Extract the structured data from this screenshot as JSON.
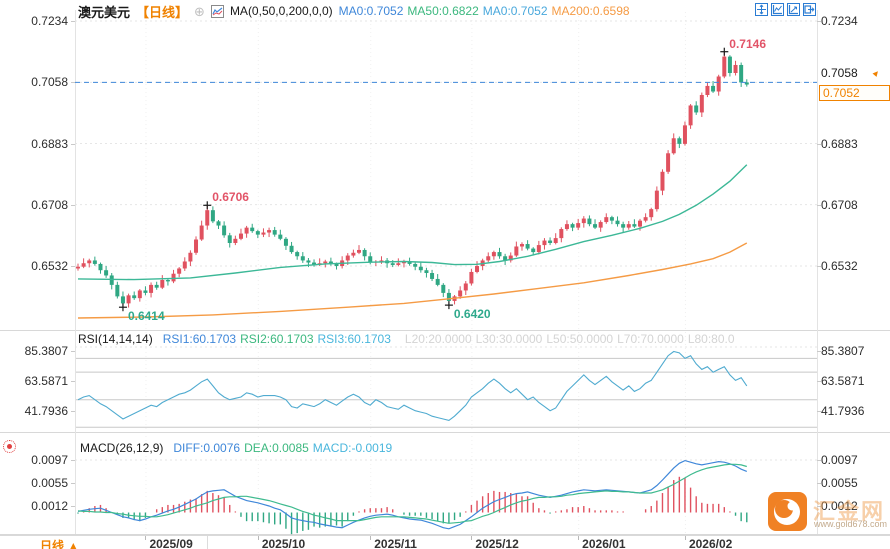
{
  "header": {
    "symbol": "澳元美元",
    "period": "【日线】",
    "collapse_icon": "⊕",
    "ma_label": "MA(0,50,0,200,0,0)",
    "ma_values": [
      {
        "label": "MA0:0.7052",
        "color": "#3f87d9"
      },
      {
        "label": "MA50:0.6822",
        "color": "#3cb87f"
      },
      {
        "label": "MA0:0.7052",
        "color": "#49a8dc"
      },
      {
        "label": "MA200:0.6598",
        "color": "#f59b45"
      }
    ]
  },
  "toolbar_icons": [
    "move-icon",
    "fit-chart-icon",
    "axis-scale-icon",
    "pan-right-icon"
  ],
  "rsi_header": {
    "title": "RSI(14,14,14)",
    "values": [
      {
        "label": "RSI1:60.1703",
        "color": "#3f87d9"
      },
      {
        "label": "RSI2:60.1703",
        "color": "#3cb87f"
      },
      {
        "label": "RSI3:60.1703",
        "color": "#49b6dc"
      }
    ],
    "levels": [
      "L20:20.0000",
      "L30:30.0000",
      "L50:50.0000",
      "L70:70.0000",
      "L80:80.0"
    ]
  },
  "macd_header": {
    "title": "MACD(26,12,9)",
    "values": [
      {
        "label": "DIFF:0.0076",
        "color": "#3f87d9"
      },
      {
        "label": "DEA:0.0085",
        "color": "#3cb87f"
      },
      {
        "label": "MACD:-0.0019",
        "color": "#49b6dc"
      }
    ]
  },
  "right_tags": {
    "prev_close": "0.7058",
    "arrow": "▲",
    "current": "0.7052"
  },
  "bottom_bar": {
    "period": "日线",
    "arrow": "▲"
  },
  "watermark": {
    "name": "汇金网",
    "url": "www.gold678.com"
  },
  "colors": {
    "up": "#e0515f",
    "down": "#2fa783",
    "ma50": "#3cb897",
    "ma200": "#f59b45",
    "rsi_line": "#50abd0",
    "diff": "#3f87d9",
    "dea": "#3fbb8f",
    "hist_up": "#e0515f",
    "hist_down": "#2fa783",
    "accent": "#f08200",
    "icon_blue": "#2b7cd3",
    "grid": "#e6e6e6",
    "rsi_grid": "#c8c8c8",
    "axis_text": "#2d2d2d",
    "dash_line": "#3f87d9",
    "cross": "#1a1a1a",
    "ann_up": "#e25468",
    "ann_down": "#2fa98c"
  },
  "chart_data": {
    "type": "candlestick",
    "title": "澳元美元 日线 (AUD/USD daily with MA, RSI, MACD)",
    "price_axis_labels": [
      0.7234,
      0.7058,
      0.6883,
      0.6708,
      0.6532
    ],
    "price_ylim": [
      0.6343,
      0.72655
    ],
    "prev_close_line": 0.7058,
    "current_price": 0.7052,
    "closes": [
      0.653,
      0.654,
      0.6548,
      0.6538,
      0.652,
      0.6505,
      0.6478,
      0.6445,
      0.6425,
      0.6448,
      0.644,
      0.6462,
      0.6455,
      0.6478,
      0.647,
      0.6492,
      0.6488,
      0.651,
      0.6525,
      0.6545,
      0.657,
      0.6608,
      0.6648,
      0.6692,
      0.666,
      0.6648,
      0.662,
      0.6598,
      0.661,
      0.6625,
      0.6642,
      0.6632,
      0.6622,
      0.6628,
      0.6635,
      0.6622,
      0.661,
      0.659,
      0.6572,
      0.656,
      0.6548,
      0.6542,
      0.6536,
      0.654,
      0.6545,
      0.6538,
      0.6532,
      0.6548,
      0.6562,
      0.657,
      0.6578,
      0.656,
      0.6542,
      0.6545,
      0.6548,
      0.654,
      0.6535,
      0.654,
      0.6545,
      0.6538,
      0.653,
      0.652,
      0.6512,
      0.6495,
      0.6478,
      0.6455,
      0.6432,
      0.6445,
      0.6462,
      0.6482,
      0.6515,
      0.6532,
      0.6548,
      0.656,
      0.6572,
      0.656,
      0.6548,
      0.6562,
      0.6588,
      0.6595,
      0.6582,
      0.6572,
      0.6592,
      0.6605,
      0.6598,
      0.6612,
      0.6638,
      0.6652,
      0.6642,
      0.6655,
      0.6668,
      0.6652,
      0.6642,
      0.6658,
      0.6672,
      0.6662,
      0.6652,
      0.6642,
      0.6652,
      0.6645,
      0.6662,
      0.6672,
      0.6695,
      0.6748,
      0.6802,
      0.6855,
      0.6898,
      0.6882,
      0.6935,
      0.6992,
      0.6972,
      0.7022,
      0.7048,
      0.7032,
      0.7075,
      0.7132,
      0.7085,
      0.7108,
      0.7058,
      0.7052
    ],
    "first_open": 0.6525,
    "wick_up_cycle": [
      0.0009,
      0.0014,
      0.0005,
      0.0011,
      0.0004,
      0.0012,
      0.0007
    ],
    "wick_dn_cycle": [
      0.0006,
      0.0004,
      0.0012,
      0.0005,
      0.001,
      0.0007,
      0.0013
    ],
    "extremes": {
      "8": {
        "low": 0.6414
      },
      "23": {
        "high": 0.6706
      },
      "66": {
        "low": 0.642
      },
      "115": {
        "high": 0.7146
      }
    },
    "annotations": [
      {
        "index": 8,
        "pos": "low",
        "text": "0.6414"
      },
      {
        "index": 23,
        "pos": "high",
        "text": "0.6706"
      },
      {
        "index": 66,
        "pos": "low",
        "text": "0.6420"
      },
      {
        "index": 115,
        "pos": "high",
        "text": "0.7146"
      }
    ],
    "ma50_points": [
      [
        0,
        0.6495
      ],
      [
        10,
        0.6493
      ],
      [
        20,
        0.6498
      ],
      [
        28,
        0.6512
      ],
      [
        36,
        0.6528
      ],
      [
        44,
        0.6538
      ],
      [
        52,
        0.6543
      ],
      [
        58,
        0.6545
      ],
      [
        63,
        0.6542
      ],
      [
        67,
        0.6536
      ],
      [
        71,
        0.6537
      ],
      [
        75,
        0.6545
      ],
      [
        80,
        0.656
      ],
      [
        85,
        0.658
      ],
      [
        90,
        0.6602
      ],
      [
        95,
        0.662
      ],
      [
        100,
        0.664
      ],
      [
        104,
        0.666
      ],
      [
        107,
        0.668
      ],
      [
        110,
        0.6706
      ],
      [
        113,
        0.6738
      ],
      [
        116,
        0.6775
      ],
      [
        119,
        0.6822
      ]
    ],
    "ma200_points": [
      [
        0,
        0.6383
      ],
      [
        12,
        0.6386
      ],
      [
        24,
        0.6392
      ],
      [
        36,
        0.6402
      ],
      [
        48,
        0.6414
      ],
      [
        58,
        0.6425
      ],
      [
        66,
        0.6438
      ],
      [
        74,
        0.6452
      ],
      [
        82,
        0.6468
      ],
      [
        90,
        0.6484
      ],
      [
        98,
        0.6505
      ],
      [
        104,
        0.6522
      ],
      [
        109,
        0.6538
      ],
      [
        113,
        0.6553
      ],
      [
        116,
        0.6572
      ],
      [
        119,
        0.6598
      ]
    ],
    "rsi_axis_labels": [
      85.3807,
      63.5871,
      41.7936
    ],
    "rsi_ylim": [
      26.54,
      88.29
    ],
    "rsi_gridlines": [
      80,
      70,
      50,
      30
    ],
    "rsi": [
      50,
      52,
      53,
      50,
      47,
      45,
      42,
      39,
      36,
      38,
      40,
      42,
      44,
      46,
      45,
      48,
      50,
      52,
      54,
      55,
      57,
      60,
      63,
      65,
      60,
      55,
      52,
      50,
      51,
      52,
      55,
      54,
      52,
      53,
      53,
      53,
      52,
      50,
      45,
      44,
      47,
      46,
      45,
      47,
      50,
      48,
      46,
      49,
      52,
      54,
      52,
      48,
      46,
      50,
      48,
      45,
      44,
      43,
      46,
      44,
      42,
      41,
      40,
      38,
      37,
      36,
      35,
      38,
      42,
      46,
      52,
      55,
      58,
      62,
      65,
      62,
      58,
      55,
      58,
      54,
      50,
      52,
      48,
      45,
      42,
      44,
      50,
      56,
      60,
      64,
      68,
      64,
      61,
      64,
      67,
      63,
      60,
      57,
      60,
      56,
      58,
      62,
      64,
      70,
      76,
      82,
      85,
      84,
      80,
      82,
      76,
      72,
      74,
      70,
      72,
      74,
      68,
      64,
      66,
      60
    ],
    "macd_axis_labels": [
      0.0097,
      0.0055,
      0.0012
    ],
    "macd_ylim": [
      -0.0036,
      0.01118
    ],
    "macd_dashed_gridline": 0.0097,
    "macd_diff": [
      0.0002,
      0.0004,
      0.0006,
      0.0007,
      0.0008,
      0.0004,
      0.0,
      -0.0004,
      -0.0008,
      -0.001,
      -0.0013,
      -0.0015,
      -0.0012,
      -0.0008,
      -0.0005,
      -0.0001,
      0.0003,
      0.0006,
      0.001,
      0.0015,
      0.002,
      0.0025,
      0.0032,
      0.0038,
      0.004,
      0.0041,
      0.0042,
      0.0036,
      0.003,
      0.0026,
      0.0022,
      0.002,
      0.0018,
      0.0015,
      0.0012,
      0.0008,
      0.0005,
      -0.0002,
      -0.001,
      -0.0013,
      -0.0015,
      -0.0017,
      -0.0018,
      -0.0021,
      -0.0023,
      -0.0025,
      -0.0027,
      -0.0028,
      -0.0023,
      -0.0018,
      -0.0014,
      -0.001,
      -0.0007,
      -0.0005,
      -0.0004,
      -0.0003,
      -0.0005,
      -0.0008,
      -0.001,
      -0.0012,
      -0.0013,
      -0.0014,
      -0.0017,
      -0.002,
      -0.0024,
      -0.0028,
      -0.003,
      -0.0026,
      -0.0022,
      -0.0015,
      -0.0008,
      0.0,
      0.0008,
      0.0014,
      0.002,
      0.0024,
      0.0028,
      0.0032,
      0.0035,
      0.0036,
      0.0038,
      0.0035,
      0.0032,
      0.003,
      0.0028,
      0.003,
      0.0032,
      0.0035,
      0.0038,
      0.004,
      0.0042,
      0.0041,
      0.004,
      0.0041,
      0.0042,
      0.0041,
      0.004,
      0.0039,
      0.0038,
      0.0037,
      0.0036,
      0.0039,
      0.0042,
      0.005,
      0.006,
      0.0071,
      0.0082,
      0.0091,
      0.0096,
      0.0093,
      0.009,
      0.0088,
      0.009,
      0.0092,
      0.0094,
      0.0093,
      0.009,
      0.0086,
      0.008,
      0.0076
    ],
    "macd_dea": [
      0.0003,
      0.0002,
      0.0002,
      0.0001,
      0.0001,
      0.0,
      0.0,
      -0.0002,
      -0.0003,
      -0.0005,
      -0.0006,
      -0.0007,
      -0.0007,
      -0.0008,
      -0.0008,
      -0.0006,
      -0.0004,
      -0.0001,
      0.0002,
      0.0005,
      0.0008,
      0.0012,
      0.0015,
      0.0018,
      0.0022,
      0.0025,
      0.0028,
      0.0029,
      0.0029,
      0.003,
      0.003,
      0.0028,
      0.0026,
      0.0024,
      0.0022,
      0.0019,
      0.0016,
      0.0013,
      0.001,
      0.0006,
      0.0002,
      -0.0001,
      -0.0005,
      -0.0007,
      -0.001,
      -0.0012,
      -0.0015,
      -0.0015,
      -0.0015,
      -0.0015,
      -0.0015,
      -0.0013,
      -0.0011,
      -0.0009,
      -0.0008,
      -0.0008,
      -0.0008,
      -0.0008,
      -0.0008,
      -0.0009,
      -0.001,
      -0.0011,
      -0.0012,
      -0.0014,
      -0.0016,
      -0.0018,
      -0.002,
      -0.0019,
      -0.0018,
      -0.0016,
      -0.0015,
      -0.0011,
      -0.0007,
      -0.0004,
      0.0,
      0.0005,
      0.0009,
      0.0014,
      0.0018,
      0.0021,
      0.0023,
      0.0026,
      0.0028,
      0.0028,
      0.0029,
      0.0029,
      0.003,
      0.0032,
      0.0033,
      0.0035,
      0.0036,
      0.0037,
      0.0038,
      0.0039,
      0.004,
      0.0039,
      0.0039,
      0.0038,
      0.0038,
      0.0037,
      0.0036,
      0.0036,
      0.0036,
      0.0039,
      0.0042,
      0.0047,
      0.0052,
      0.0058,
      0.0064,
      0.007,
      0.0075,
      0.0079,
      0.0082,
      0.0084,
      0.0086,
      0.0088,
      0.0089,
      0.0089,
      0.0088,
      0.0085
    ],
    "hist_rule": "2*(diff-dea)",
    "months": [
      {
        "index": 12,
        "label": "2025/09"
      },
      {
        "index": 32,
        "label": "2025/10"
      },
      {
        "index": 52,
        "label": "2025/11"
      },
      {
        "index": 70,
        "label": "2025/12"
      },
      {
        "index": 89,
        "label": "2026/01"
      },
      {
        "index": 108,
        "label": "2026/02"
      }
    ]
  }
}
